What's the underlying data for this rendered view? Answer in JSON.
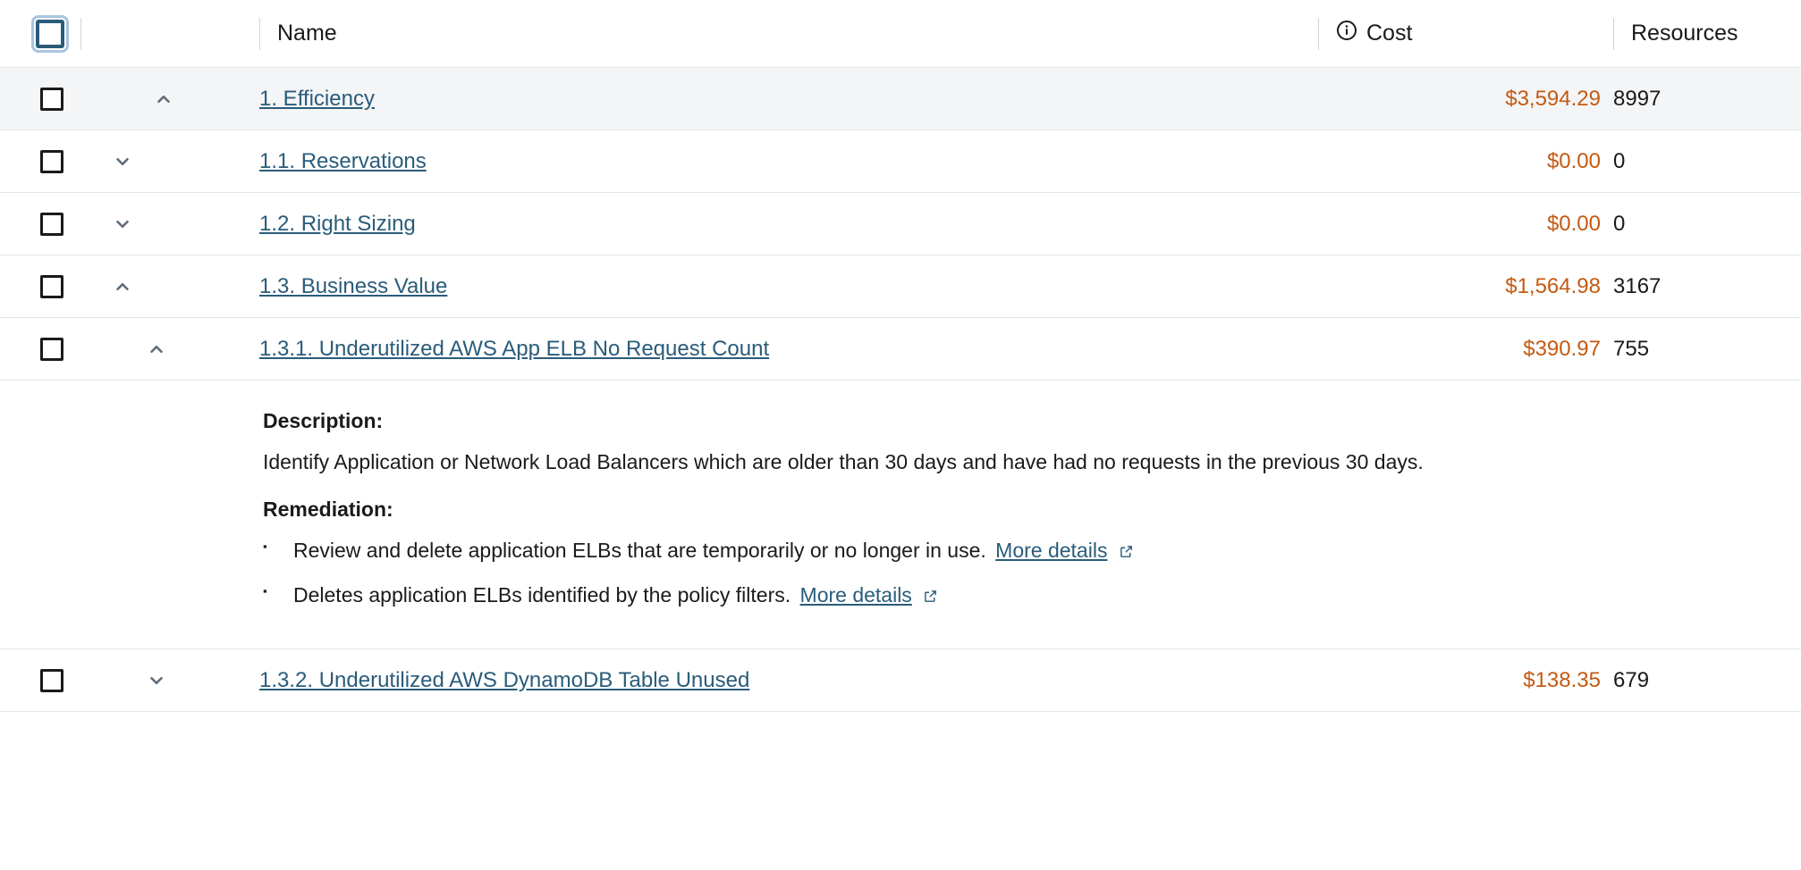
{
  "columns": {
    "name": "Name",
    "cost": "Cost",
    "resources": "Resources"
  },
  "rows": [
    {
      "id": "efficiency",
      "indent": 0,
      "expanded": true,
      "name": "1. Efficiency",
      "cost": "$3,594.29",
      "resources": "8997"
    },
    {
      "id": "reservations",
      "indent": 1,
      "expanded": false,
      "name": "1.1. Reservations",
      "cost": "$0.00",
      "resources": "0"
    },
    {
      "id": "right-sizing",
      "indent": 1,
      "expanded": false,
      "name": "1.2. Right Sizing",
      "cost": "$0.00",
      "resources": "0"
    },
    {
      "id": "business-value",
      "indent": 1,
      "expanded": true,
      "name": "1.3. Business Value",
      "cost": "$1,564.98",
      "resources": "3167"
    },
    {
      "id": "elb-no-request",
      "indent": 2,
      "expanded": true,
      "name": "1.3.1. Underutilized AWS App ELB No Request Count",
      "cost": "$390.97",
      "resources": "755"
    },
    {
      "id": "dynamodb-unused",
      "indent": 2,
      "expanded": false,
      "name": "1.3.2. Underutilized AWS DynamoDB Table Unused",
      "cost": "$138.35",
      "resources": "679"
    }
  ],
  "detail": {
    "afterRow": "elb-no-request",
    "description_label": "Description:",
    "description_text": "Identify Application or Network Load Balancers which are older than 30 days and have had no requests in the previous 30 days.",
    "remediation_label": "Remediation:",
    "remediation_items": [
      {
        "text": "Review and delete application ELBs that are temporarily or no longer in use.",
        "link": "More details"
      },
      {
        "text": "Deletes application ELBs identified by the policy filters.",
        "link": "More details"
      }
    ]
  },
  "colors": {
    "link": "#2a5c7a",
    "cost": "#c55a11"
  }
}
